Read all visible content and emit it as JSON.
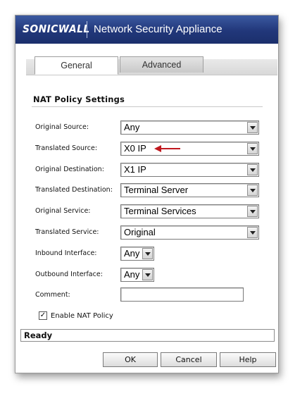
{
  "header": {
    "logo": "SONICWALL",
    "title": "Network Security Appliance"
  },
  "tabs": [
    {
      "label": "General",
      "active": true
    },
    {
      "label": "Advanced",
      "active": false
    }
  ],
  "section": {
    "title": "NAT Policy Settings"
  },
  "fields": [
    {
      "label": "Original Source:",
      "value": "Any"
    },
    {
      "label": "Translated Source:",
      "value": "X0 IP"
    },
    {
      "label": "Original Destination:",
      "value": "X1 IP"
    },
    {
      "label": "Translated Destination:",
      "value": "Terminal Server"
    },
    {
      "label": "Original Service:",
      "value": "Terminal Services"
    },
    {
      "label": "Translated Service:",
      "value": "Original"
    },
    {
      "label": "Inbound Interface:",
      "value": "Any"
    },
    {
      "label": "Outbound Interface:",
      "value": "Any"
    },
    {
      "label": "Comment:",
      "value": ""
    }
  ],
  "enable_nat": {
    "label": "Enable NAT Policy",
    "checked": true
  },
  "status": {
    "text": "Ready"
  },
  "buttons": {
    "ok": "OK",
    "cancel": "Cancel",
    "help": "Help"
  },
  "colors": {
    "header_top": "#3b59a0",
    "header_bottom": "#1b2f6c",
    "annotation_arrow": "#c0191f"
  },
  "icons": {
    "dropdown": "chevron-down-icon",
    "annotation": "red-arrow-icon",
    "checkbox": "checkmark-icon"
  }
}
